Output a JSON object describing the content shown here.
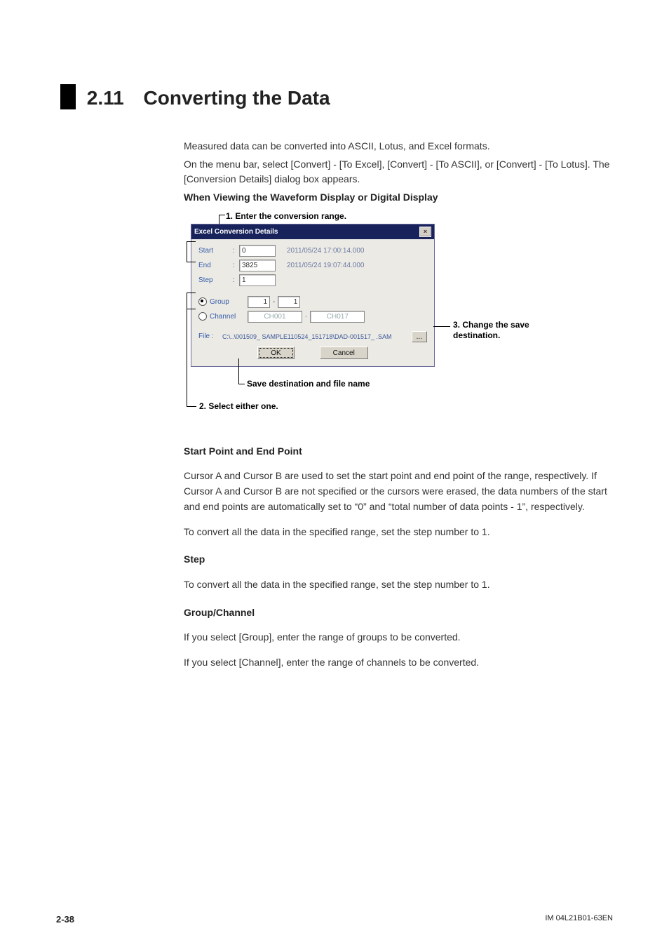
{
  "heading": {
    "number": "2.11",
    "title": "Converting the Data"
  },
  "intro": {
    "p1": "Measured data can be converted into ASCII, Lotus, and Excel formats.",
    "p2": "On the menu bar, select [Convert] - [To Excel], [Convert] - [To ASCII], or [Convert] - [To Lotus]. The [Conversion Details] dialog box appears."
  },
  "when_heading": "When Viewing the Waveform Display or Digital Display",
  "callouts": {
    "c1": "1. Enter the conversion range.",
    "c2": "2. Select either one.",
    "c3_a": "3. Change the save",
    "c3_b": "destination.",
    "save_dest": "Save destination and file name"
  },
  "dialog": {
    "title": "Excel Conversion Details",
    "start_label": "Start",
    "end_label": "End",
    "step_label": "Step",
    "start_val": "0",
    "end_val": "3825",
    "step_val": "1",
    "start_ts": "2011/05/24 17:00:14.000",
    "end_ts": "2011/05/24 19:07:44.000",
    "group_label": "Group",
    "channel_label": "Channel",
    "g1": "1",
    "g2": "1",
    "dash": "-",
    "ch1": "CH001",
    "ch2": "CH017",
    "file_label": "File :",
    "file_val": "C:\\..\\001509_ SAMPLE110524_151718\\DAD-001517_ .SAM",
    "browse": "...",
    "ok": "OK",
    "cancel": "Cancel"
  },
  "sections": {
    "sp_h": "Start Point and End Point",
    "sp_p1": "Cursor A and Cursor B are used to set the start point and end point of the range, respectively. If Cursor A and Cursor B are not specified or the cursors were erased, the data numbers of the start and end points are automatically set to “0” and “total number of data points - 1”, respectively.",
    "sp_p2": "To convert all the data in the specified range, set the step number to 1.",
    "step_h": "Step",
    "step_p": "To convert all the data in the specified range, set the step number to 1.",
    "gc_h": "Group/Channel",
    "gc_p1": "If you select [Group], enter the range of groups to be converted.",
    "gc_p2": "If you select [Channel], enter the range of channels to be converted."
  },
  "footer": {
    "page": "2-38",
    "doc": "IM 04L21B01-63EN"
  }
}
